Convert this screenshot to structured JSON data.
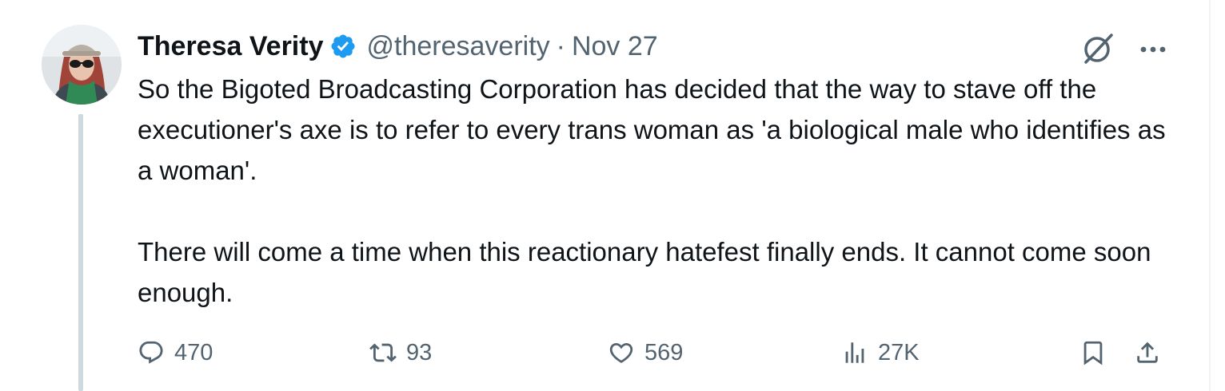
{
  "tweet": {
    "author_name": "Theresa Verity",
    "handle": "@theresaverity",
    "separator": "·",
    "date": "Nov 27",
    "paragraphs": [
      "So the Bigoted Broadcasting Corporation has decided that the way to stave off the executioner's axe is to refer to every trans woman as 'a biological male who identifies as a woman'.",
      "There will come a time when this reactionary hatefest finally ends. It cannot come soon enough."
    ]
  },
  "actions": {
    "replies": "470",
    "reposts": "93",
    "likes": "569",
    "views": "27K"
  },
  "icons": {
    "verified": "verified-badge-icon",
    "grok": "grok-icon",
    "more": "more-icon",
    "reply": "reply-icon",
    "repost": "repost-icon",
    "like": "heart-icon",
    "views": "views-icon",
    "bookmark": "bookmark-icon",
    "share": "share-icon"
  },
  "colors": {
    "text": "#0f1419",
    "muted": "#536471",
    "verified_blue": "#1d9bf0",
    "thread_line": "#cfd9de"
  }
}
